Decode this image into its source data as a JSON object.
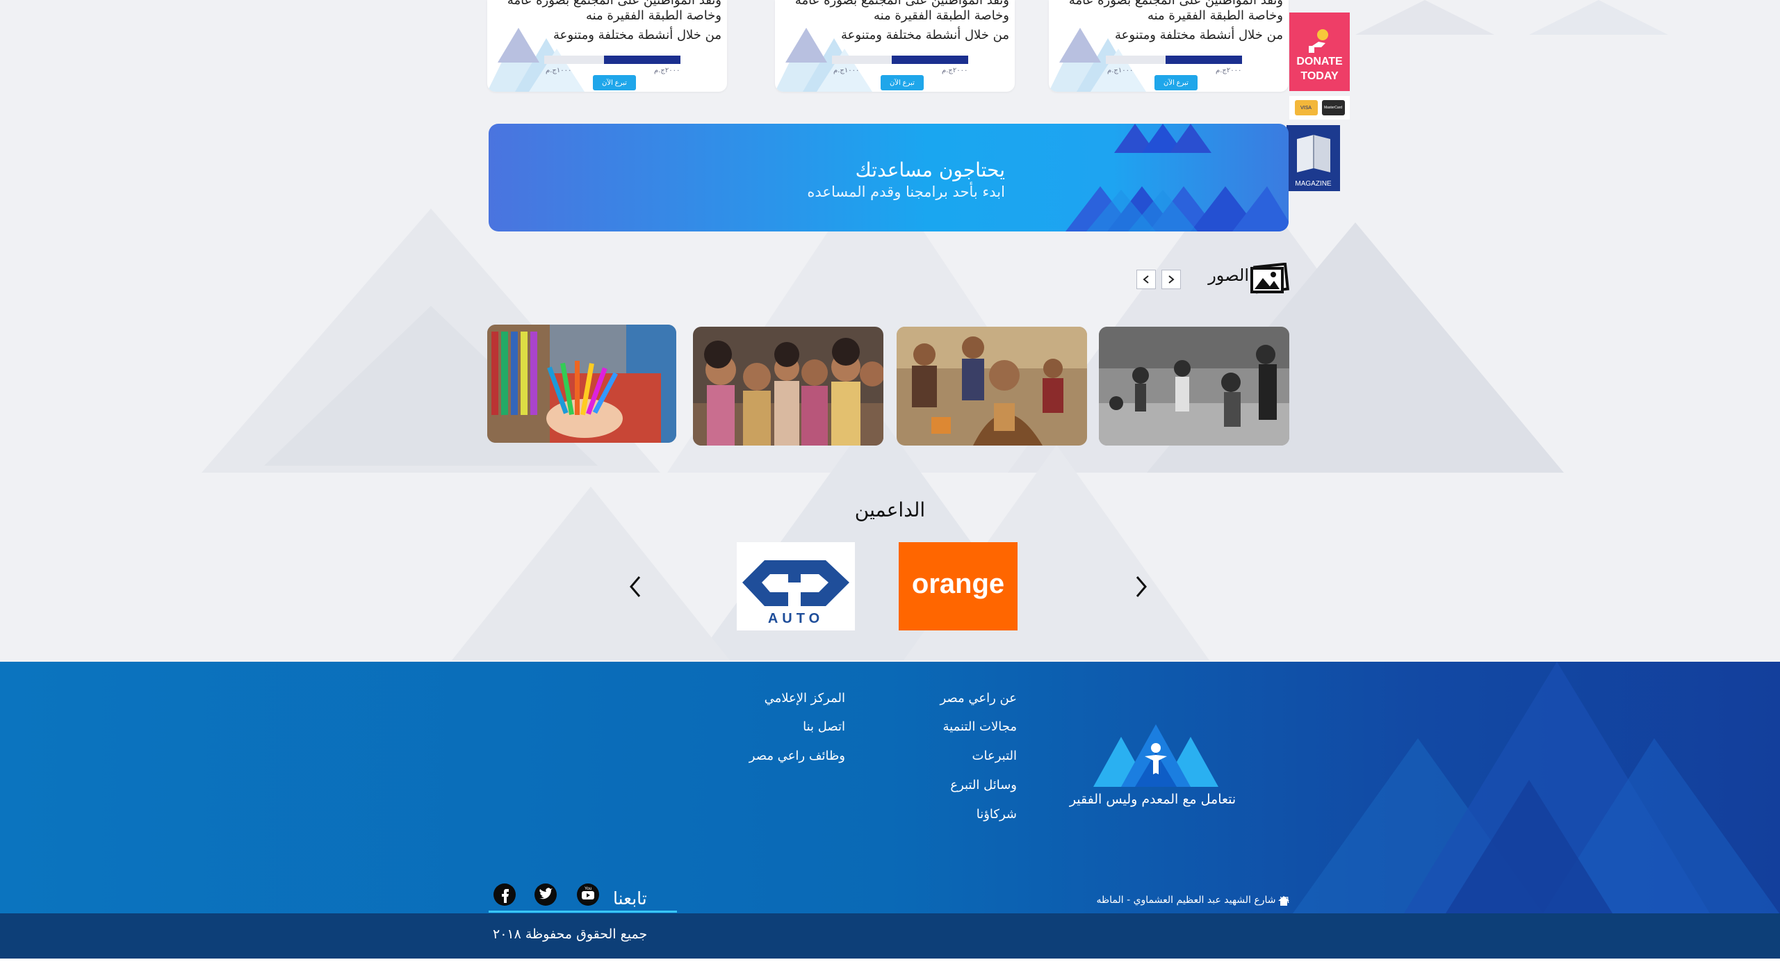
{
  "campaign_cards": [
    {
      "lines": [
        "ونقد المواطنين على المجتمع بصورة عامة",
        "وخاصة الطبقة الفقيرة منه",
        "من خلال أنشطة مختلفة ومتنوعة"
      ],
      "raised": "١٠٠٠ج.م",
      "goal": "٢٠٠٠ج.م",
      "donate_label": "تبرع الآن",
      "progress": 0.55
    },
    {
      "lines": [
        "ونقد المواطنين على المجتمع بصورة عامة",
        "وخاصة الطبقة الفقيرة منه",
        "من خلال أنشطة مختلفة ومتنوعة"
      ],
      "raised": "١٠٠٠ج.م",
      "goal": "٢٠٠٠ج.م",
      "donate_label": "تبرع الآن",
      "progress": 0.55
    },
    {
      "lines": [
        "ونقد المواطنين على المجتمع بصورة عامة",
        "وخاصة الطبقة الفقيرة منه",
        "من خلال أنشطة مختلفة ومتنوعة"
      ],
      "raised": "١٠٠٠ج.م",
      "goal": "٢٠٠٠ج.م",
      "donate_label": "تبرع الآن",
      "progress": 0.55
    }
  ],
  "side_widgets": {
    "donate_line1": "DONATE",
    "donate_line2": "TODAY",
    "visa": "VISA",
    "mastercard": "MasterCard",
    "magazine": "MAGAZINE"
  },
  "banner": {
    "title": "يحتاجون مساعدتك",
    "subtitle": "ابدء بأحد برامجنا وقدم المساعده"
  },
  "photos": {
    "title": "الصور",
    "icon": "photos-icon",
    "prev_icon": "chevron-left-icon",
    "next_icon": "chevron-right-icon"
  },
  "supporters": {
    "title": "الداعمين",
    "sponsors": [
      "orange",
      "AUTO"
    ]
  },
  "footer": {
    "tagline": "نتعامل مع المعدم وليس الفقير",
    "col1": [
      "عن راعي مصر",
      "مجالات التنمية",
      "التبرعات",
      "وسائل التبرع",
      "شركاؤنا"
    ],
    "col2": [
      "المركز الإعلامي",
      "اتصل بنا",
      "وظائف راعي مصر"
    ],
    "address": "١٦ شارع الشهيد عبد العظيم العشماوي - الماظه",
    "follow": "تابعنا",
    "social": [
      "facebook-icon",
      "twitter-icon",
      "youtube-icon"
    ]
  },
  "copyright": "جميع الحقوق محفوظة ٢٠١٨",
  "colors": {
    "accent": "#1fa6ea",
    "donate": "#ee3e67",
    "footer": "#0a69b6",
    "footer_bottom": "#0d3f78",
    "progress": "#1b2f8f",
    "orange": "#ff6600"
  }
}
